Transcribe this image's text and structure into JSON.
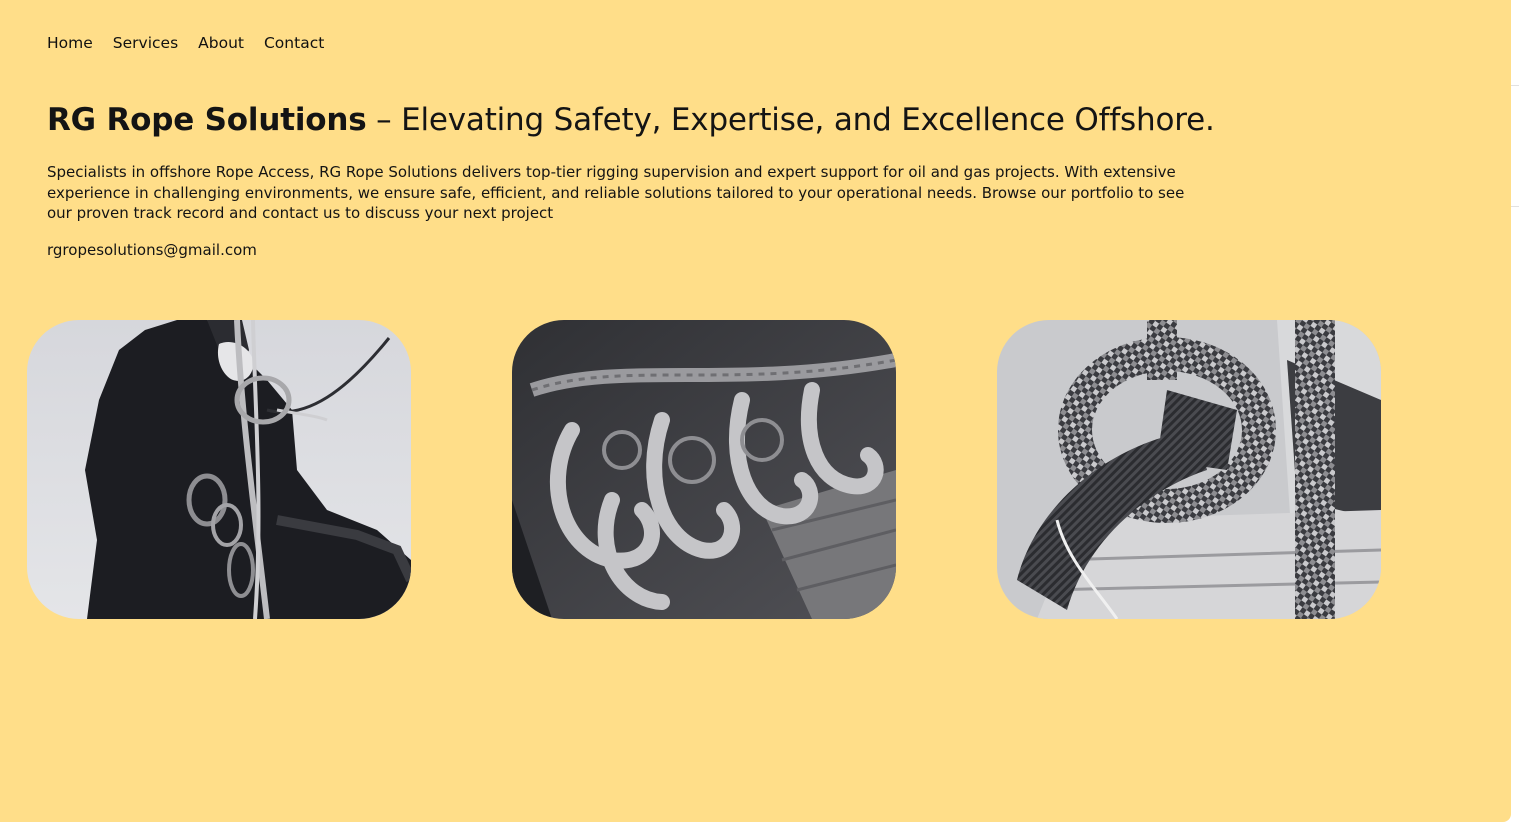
{
  "nav": {
    "items": [
      {
        "label": "Home"
      },
      {
        "label": "Services"
      },
      {
        "label": "About"
      },
      {
        "label": "Contact"
      }
    ]
  },
  "hero": {
    "brand": "RG Rope Solutions",
    "tagline": " – Elevating Safety, Expertise, and Excellence Offshore.",
    "description": "Specialists in offshore Rope Access, RG Rope Solutions delivers top-tier rigging supervision and expert support for oil and gas projects. With extensive experience in challenging environments, we ensure safe, efficient, and reliable solutions tailored to your operational needs. Browse our portfolio to see our proven track record and contact us to discuss your next project",
    "email": "rgropesolutions@gmail.com"
  },
  "gallery": {
    "images": [
      {
        "subject": "rope-access-technician-photo"
      },
      {
        "subject": "rigging-hooks-and-slings-photo"
      },
      {
        "subject": "climbing-rope-knot-photo"
      }
    ]
  },
  "colors": {
    "page_background": "#ffde89",
    "text": "#141414"
  }
}
